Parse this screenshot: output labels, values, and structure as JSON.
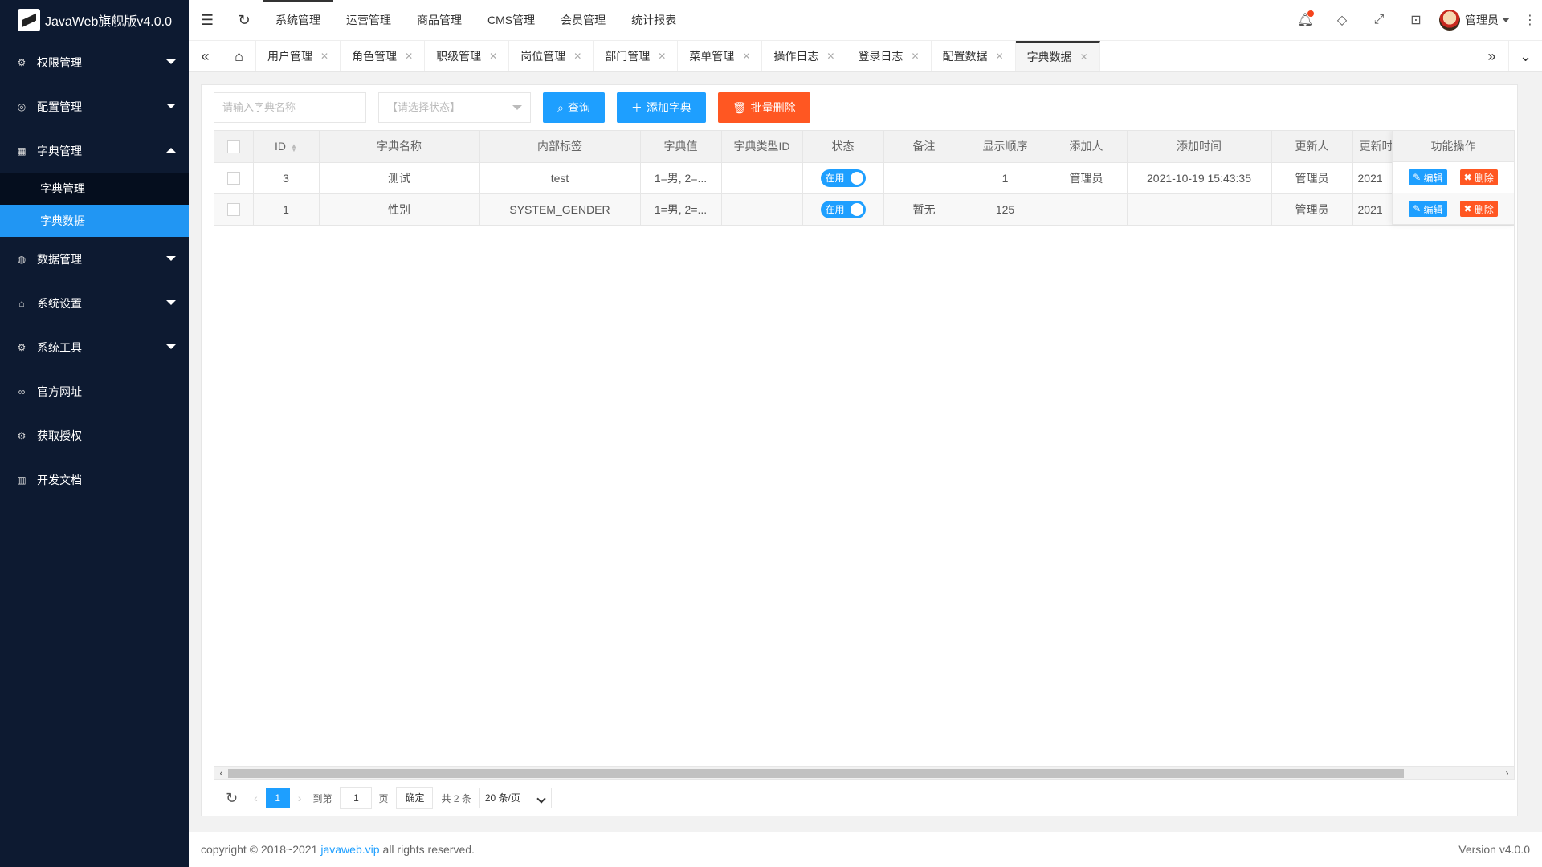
{
  "app": {
    "title": "JavaWeb旗舰版v4.0.0"
  },
  "sidebar": {
    "items": [
      {
        "label": "权限管理",
        "icon": "gear-icon",
        "expandable": true
      },
      {
        "label": "配置管理",
        "icon": "target-icon",
        "expandable": true
      },
      {
        "label": "字典管理",
        "icon": "grid-icon",
        "expandable": true,
        "expanded": true
      },
      {
        "label": "数据管理",
        "icon": "palette-icon",
        "expandable": true
      },
      {
        "label": "系统设置",
        "icon": "home-icon",
        "expandable": true
      },
      {
        "label": "系统工具",
        "icon": "gear-icon",
        "expandable": true
      },
      {
        "label": "官方网址",
        "icon": "link-icon",
        "expandable": false
      },
      {
        "label": "获取授权",
        "icon": "gear-icon",
        "expandable": false
      },
      {
        "label": "开发文档",
        "icon": "book-icon",
        "expandable": false
      }
    ],
    "submenu": [
      {
        "label": "字典管理"
      },
      {
        "label": "字典数据",
        "active": true
      }
    ]
  },
  "topnav": [
    "系统管理",
    "运营管理",
    "商品管理",
    "CMS管理",
    "会员管理",
    "统计报表"
  ],
  "user": {
    "name": "管理员"
  },
  "tabs": [
    "用户管理",
    "角色管理",
    "职级管理",
    "岗位管理",
    "部门管理",
    "菜单管理",
    "操作日志",
    "登录日志",
    "配置数据",
    "字典数据"
  ],
  "search": {
    "placeholder": "请输入字典名称",
    "status_placeholder": "【请选择状态】"
  },
  "buttons": {
    "query": "查询",
    "add": "添加字典",
    "batch_delete": "批量删除"
  },
  "table": {
    "columns": [
      "ID",
      "字典名称",
      "内部标签",
      "字典值",
      "字典类型ID",
      "状态",
      "备注",
      "显示顺序",
      "添加人",
      "添加时间",
      "更新人",
      "更新时间"
    ],
    "action_header": "功能操作",
    "rows": [
      {
        "id": "3",
        "name": "测试",
        "label": "test",
        "value": "1=男, 2=...",
        "type_id": "",
        "status": "在用",
        "note": "",
        "sort": "1",
        "creator": "管理员",
        "created": "2021-10-19 15:43:35",
        "updater": "管理员",
        "updated": "2021"
      },
      {
        "id": "1",
        "name": "性别",
        "label": "SYSTEM_GENDER",
        "value": "1=男, 2=...",
        "type_id": "",
        "status": "在用",
        "note": "暂无",
        "sort": "125",
        "creator": "",
        "created": "",
        "updater": "管理员",
        "updated": "2021"
      }
    ],
    "edit": "编辑",
    "delete": "删除"
  },
  "pager": {
    "current": "1",
    "goto_label": "到第",
    "page_input": "1",
    "page_unit": "页",
    "confirm": "确定",
    "total": "共 2 条",
    "size": "20 条/页"
  },
  "footer": {
    "copyright": "copyright © 2018~2021",
    "link": "javaweb.vip",
    "rights": "all rights reserved.",
    "version": "Version v4.0.0"
  }
}
